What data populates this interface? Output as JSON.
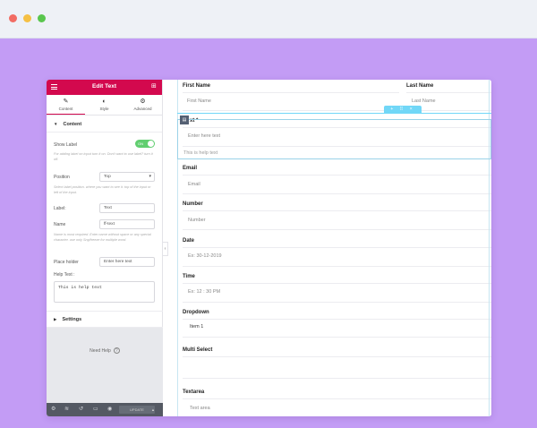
{
  "panel": {
    "title": "Edit Text",
    "tabs": [
      {
        "label": "Content",
        "icon": "pencil-icon",
        "glyph": "✎"
      },
      {
        "label": "Style",
        "icon": "contrast-icon",
        "glyph": "◐"
      },
      {
        "label": "Advanced",
        "icon": "gear-icon",
        "glyph": "⚙"
      }
    ],
    "content_section": "Content",
    "show_label": {
      "label": "Show Label",
      "toggle": "ON"
    },
    "show_label_desc": "For adding label on input turn it on. Don't want to use label? turn it off.",
    "position": {
      "label": "Position",
      "value": "Top"
    },
    "position_desc": "Select label position. where you want to see it. top of the input or left of the input.",
    "label": {
      "label": "Label:",
      "value": "Text"
    },
    "name": {
      "label": "Name",
      "value": "ff-text"
    },
    "name_desc": "Name is most required. Enter name without space or any special character. use only Sng/freeze for multiple word.",
    "placeholder": {
      "label": "Place holder",
      "value": "Enter here text"
    },
    "help_text": {
      "label": "Help Text :",
      "value": "This is help text"
    },
    "settings_section": "Settings",
    "need_help": "Need Help",
    "footer": {
      "update_label": "UPDATE",
      "update_arrow": "▲"
    }
  },
  "preview": {
    "first_name": {
      "label": "First Name",
      "placeholder": "First Name"
    },
    "last_name": {
      "label": "Last Name",
      "placeholder": "Last Name"
    },
    "text": {
      "label": "xt *",
      "placeholder": "Enter here text",
      "help": "This is help text"
    },
    "email": {
      "label": "Email",
      "placeholder": "Email"
    },
    "number": {
      "label": "Number",
      "placeholder": "Number"
    },
    "date": {
      "label": "Date",
      "placeholder": "Ex: 30-12-2019"
    },
    "time": {
      "label": "Time",
      "placeholder": "Ex: 12 : 30 PM"
    },
    "dropdown": {
      "label": "Dropdown",
      "value": "Item 1"
    },
    "multi_select": {
      "label": "Multi Select"
    },
    "textarea": {
      "label": "Textarea",
      "placeholder": "Text area"
    },
    "section_badge": "+ ⠿ ×"
  },
  "colors": {
    "accent": "#d3094e",
    "background": "#c39cf5",
    "toggle": "#61ce70",
    "section_badge": "#71d7f7"
  }
}
